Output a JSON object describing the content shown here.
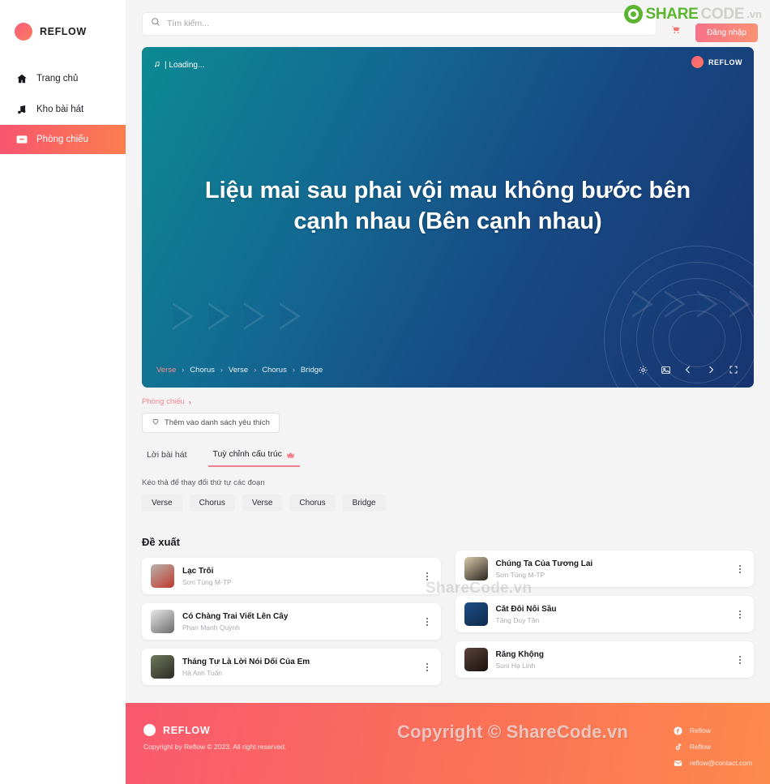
{
  "brand": {
    "name": "REFLOW"
  },
  "sidebar": {
    "items": [
      {
        "label": "Trang chủ",
        "icon": "home-icon",
        "active": false
      },
      {
        "label": "Kho bài hát",
        "icon": "music-note-icon",
        "active": false
      },
      {
        "label": "Phòng chiếu",
        "icon": "screen-icon",
        "active": true
      }
    ]
  },
  "topbar": {
    "search_placeholder": "Tìm kiếm...",
    "search_value": "",
    "search_icon": "search-icon",
    "login_label": "Đăng nhập",
    "cart_icon": "cart-icon"
  },
  "watermark": {
    "header_share": "SHARE",
    "header_code": "CODE",
    "header_vn": ".vn",
    "middle": "ShareCode.vn",
    "footer": "Copyright © ShareCode.vn"
  },
  "player": {
    "status_text": "| Loading...",
    "note_icon": "music-note-icon",
    "badge_label": "REFLOW",
    "title": "Liệu mai sau phai vội mau không bước bên cạnh nhau (Bên cạnh nhau)",
    "structure": [
      "Verse",
      "Chorus",
      "Verse",
      "Chorus",
      "Bridge"
    ],
    "current_segment_index": 0,
    "separator": "›",
    "controls": [
      {
        "name": "settings-icon",
        "label": "gear"
      },
      {
        "name": "image-icon",
        "label": "image"
      },
      {
        "name": "prev-icon",
        "label": "previous"
      },
      {
        "name": "next-icon",
        "label": "next"
      },
      {
        "name": "fullscreen-icon",
        "label": "fullscreen"
      }
    ],
    "gradient_from": "#0c8a93",
    "gradient_to": "#18346f",
    "accent": "#f78b8b"
  },
  "breadcrumb": {
    "label": "Phòng chiếu",
    "chevron": "›"
  },
  "favorite_button": {
    "label": "Thêm vào danh sách yêu thích",
    "icon": "heart-icon"
  },
  "tabs": [
    {
      "label": "Lời bài hát",
      "active": false,
      "badge": null
    },
    {
      "label": "Tuỳ chỉnh cấu trúc",
      "active": true,
      "badge": "crown-icon"
    }
  ],
  "structure_editor": {
    "hint": "Kéo thả để thay đổi thứ tự các đoạn",
    "chips": [
      "Verse",
      "Chorus",
      "Verse",
      "Chorus",
      "Bridge"
    ]
  },
  "suggestions": {
    "title": "Đề xuất",
    "items": [
      {
        "title": "Lạc Trôi",
        "artist": "Sơn Tùng M-TP",
        "thumb_colors": [
          "#b8b3ae",
          "#c0392b"
        ]
      },
      {
        "title": "Chúng Ta Của Tương Lai",
        "artist": "Sơn Tùng M-TP",
        "thumb_colors": [
          "#d8c9a8",
          "#2a2620"
        ]
      },
      {
        "title": "Có Chàng Trai Viết Lên Cây",
        "artist": "Phan Mạnh Quỳnh",
        "thumb_colors": [
          "#e8e8e8",
          "#6b6b6b"
        ]
      },
      {
        "title": "Cắt Đôi Nỗi Sầu",
        "artist": "Tăng Duy Tân",
        "thumb_colors": [
          "#1d4f86",
          "#0d2a4d"
        ]
      },
      {
        "title": "Tháng Tư Là Lời Nói Dối Của Em",
        "artist": "Hà Anh Tuấn",
        "thumb_colors": [
          "#6d7a5c",
          "#2e2a22"
        ]
      },
      {
        "title": "Răng Khộng",
        "artist": "Suni Hạ Linh",
        "thumb_colors": [
          "#5a4238",
          "#1b1210"
        ]
      }
    ],
    "kebab_icon": "more-vertical-icon"
  },
  "footer": {
    "brand": "REFLOW",
    "copyright": "Copyright by Reflow © 2023. All right reserved.",
    "links": [
      {
        "icon": "facebook-icon",
        "label": "Reflow"
      },
      {
        "icon": "tiktok-icon",
        "label": "Reflow"
      },
      {
        "icon": "mail-icon",
        "label": "reflow@contact.com"
      }
    ],
    "gradient_from": "#f9596f",
    "gradient_to": "#fc8a4d"
  }
}
